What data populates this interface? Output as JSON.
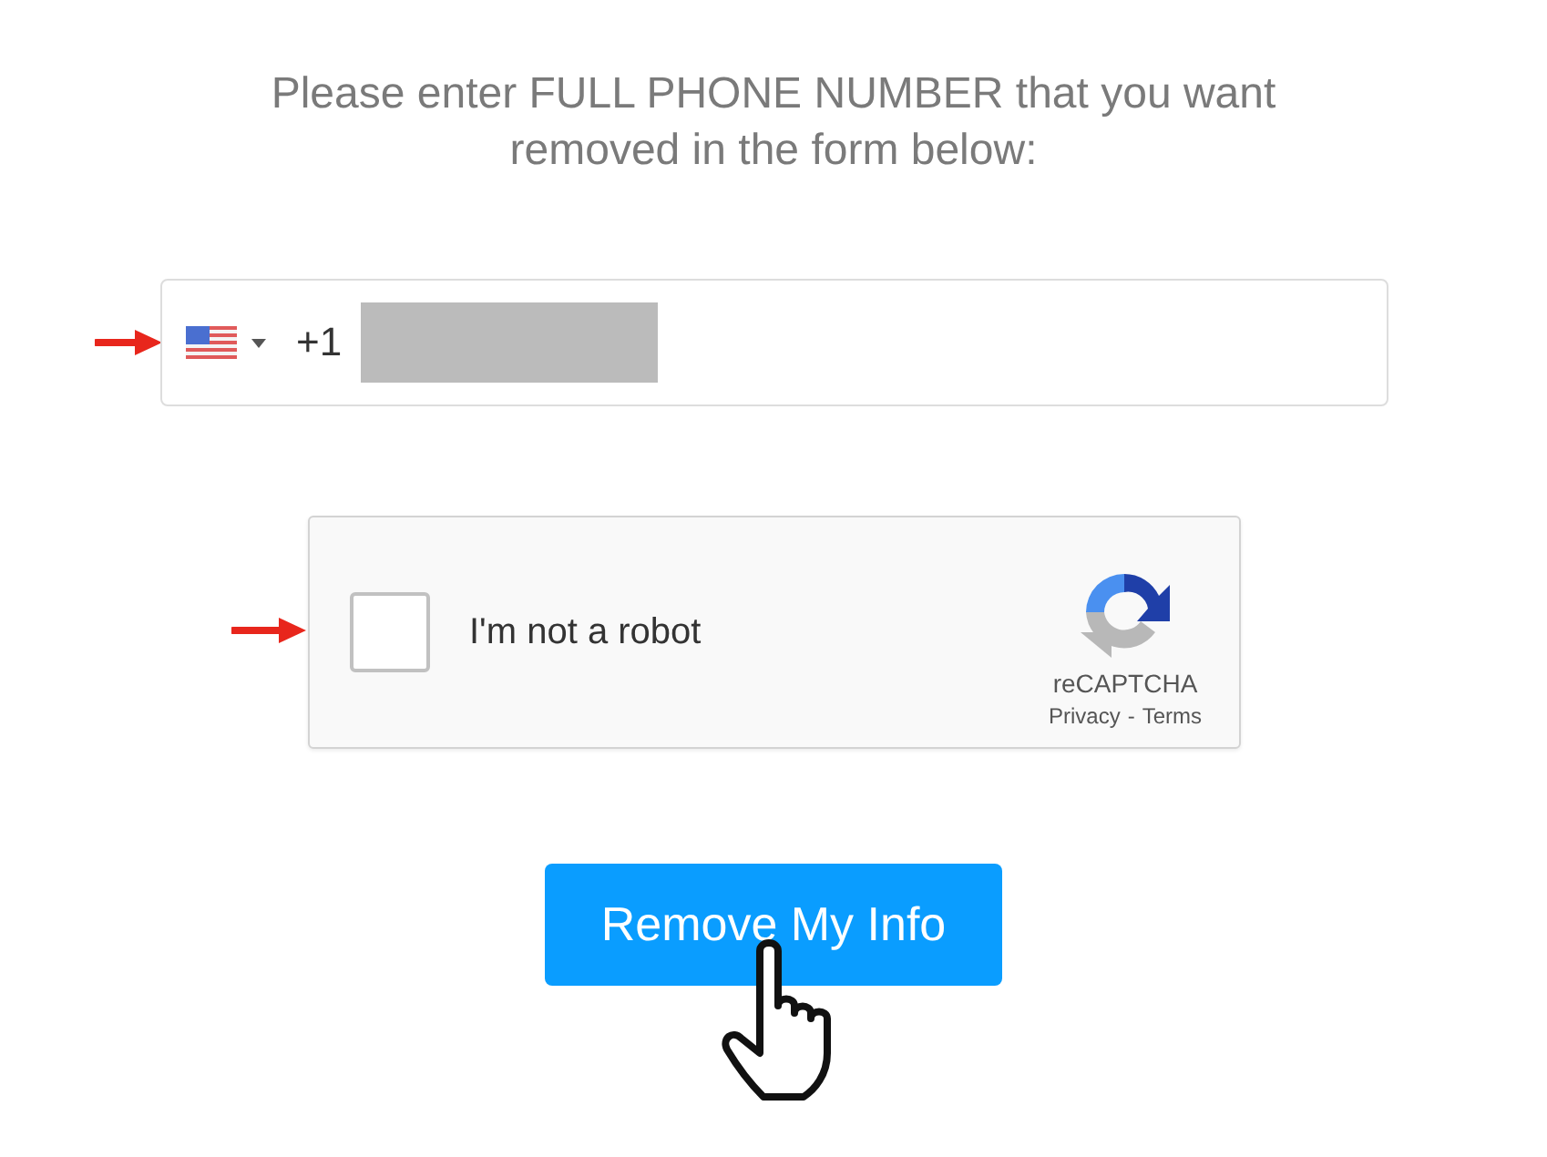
{
  "heading": "Please enter FULL PHONE NUMBER that you want removed in the form below:",
  "phone": {
    "country_code": "+1"
  },
  "captcha": {
    "label": "I'm not a robot",
    "checked": false,
    "brand": "reCAPTCHA",
    "links": [
      "Privacy",
      "Terms"
    ],
    "separator": "-"
  },
  "submit_button": {
    "label": "Remove My Info"
  }
}
